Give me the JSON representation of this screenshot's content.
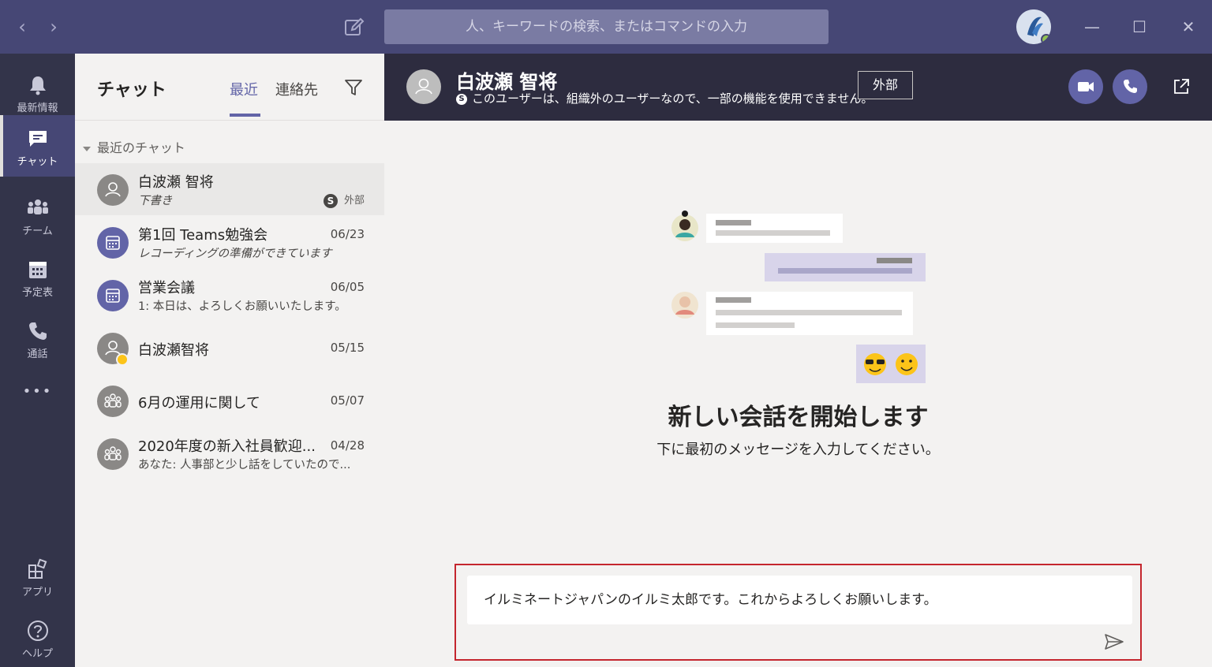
{
  "titlebar": {
    "back_icon": "chevron-left-icon",
    "forward_icon": "chevron-right-icon",
    "compose_icon": "new-chat-icon",
    "search_placeholder": "人、キーワードの検索、またはコマンドの入力",
    "window_controls": [
      "minimize",
      "maximize",
      "close"
    ]
  },
  "rail": {
    "items": [
      {
        "label": "最新情報",
        "icon": "bell-icon"
      },
      {
        "label": "チャット",
        "icon": "chat-icon",
        "active": true
      },
      {
        "label": "チーム",
        "icon": "teams-icon"
      },
      {
        "label": "予定表",
        "icon": "calendar-icon"
      },
      {
        "label": "通話",
        "icon": "phone-icon"
      },
      {
        "label": "",
        "icon": "more-icon"
      },
      {
        "label": "アプリ",
        "icon": "apps-icon"
      },
      {
        "label": "ヘルプ",
        "icon": "help-icon"
      }
    ],
    "more_glyph": "•••"
  },
  "chatlist": {
    "title": "チャット",
    "tabs": [
      "最近",
      "連絡先"
    ],
    "section": "最近のチャット",
    "items": [
      {
        "name": "白波瀬 智将",
        "preview": "下書き",
        "date": "",
        "badge": "外部",
        "skype": "S"
      },
      {
        "name": "第1回 Teams勉強会",
        "preview": "レコーディングの準備ができています",
        "date": "06/23"
      },
      {
        "name": "営業会議",
        "preview": "1: 本日は、よろしくお願いいたします。",
        "date": "06/05"
      },
      {
        "name": "白波瀬智将",
        "preview": "",
        "date": "05/15"
      },
      {
        "name": "6月の運用に関して",
        "preview": "",
        "date": "05/07"
      },
      {
        "name": "2020年度の新入社員歓迎...",
        "preview": "あなた: 人事部と少し話をしていたので...",
        "date": "04/28"
      }
    ]
  },
  "conversation": {
    "name": "白波瀬 智将",
    "subtitle": "このユーザーは、組織外のユーザーなので、一部の機能を使用できません。",
    "skype": "S",
    "tag": "外部",
    "empty_title": "新しい会話を開始します",
    "empty_sub": "下に最初のメッセージを入力してください。"
  },
  "compose": {
    "value": "イルミネートジャパンのイルミ太郎です。これからよろしくお願いします。"
  },
  "colors": {
    "titlebar": "#464775",
    "rail": "#33344a",
    "accent": "#6264a7",
    "header": "#2d2c3f",
    "highlight": "#c4262e"
  }
}
